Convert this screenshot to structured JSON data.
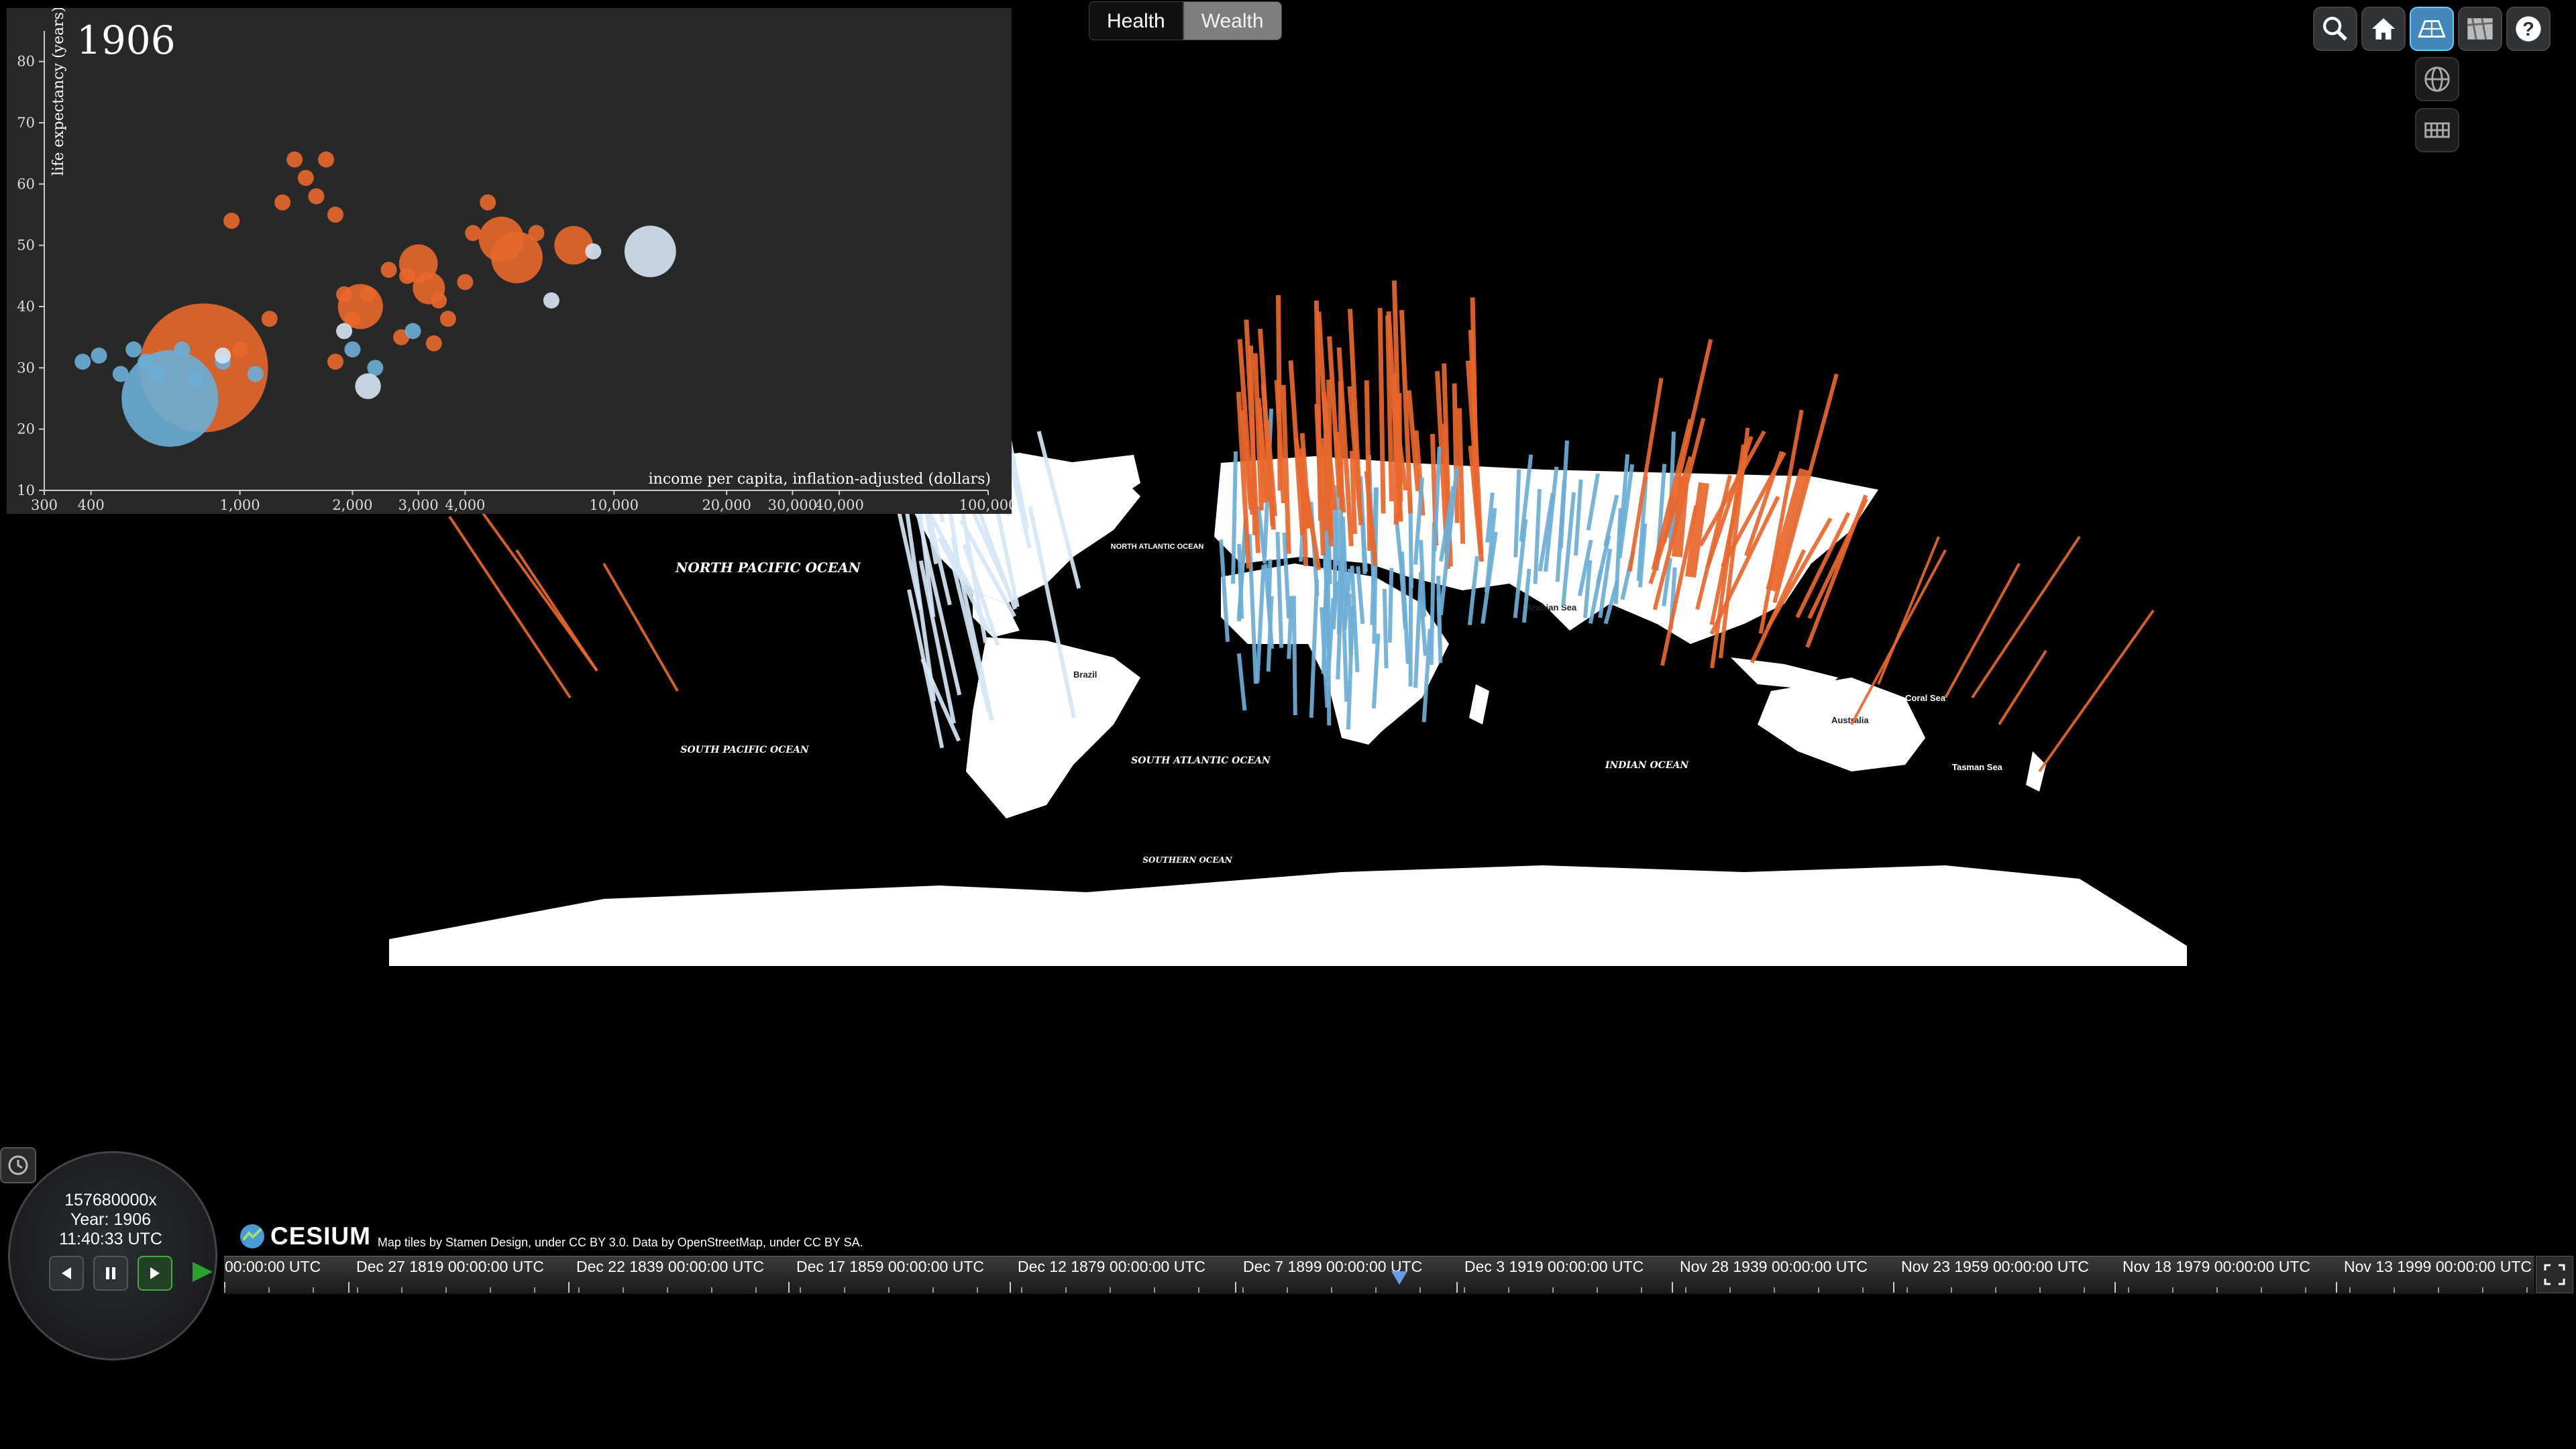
{
  "tabs": [
    {
      "label": "Health",
      "active": true
    },
    {
      "label": "Wealth",
      "active": false
    }
  ],
  "toolbar": {
    "buttons": [
      "search-icon",
      "home-icon",
      "map-2d-icon",
      "map-columbus-icon",
      "help-icon"
    ],
    "picker": [
      "globe-icon",
      "grid-icon"
    ]
  },
  "chart": {
    "year": "1906",
    "ylabel": "life expectancy (years)",
    "xlabel": "income per capita, inflation-adjusted (dollars)",
    "y_ticks": [
      "80",
      "70",
      "60",
      "50",
      "40",
      "30",
      "20",
      "10"
    ],
    "x_ticks": [
      "300",
      "400",
      "1,000",
      "2,000",
      "3,000",
      "4,000",
      "10,000",
      "20,000",
      "30,000",
      "40,000",
      "100,000"
    ]
  },
  "chart_data": {
    "type": "scatter",
    "title": "1906",
    "xlabel": "income per capita, inflation-adjusted (dollars)",
    "ylabel": "life expectancy (years)",
    "x_scale": "log",
    "xlim": [
      300,
      100000
    ],
    "ylim": [
      10,
      85
    ],
    "series": [
      {
        "name": "",
        "color": "#e8672c",
        "points": [
          {
            "x": 800,
            "y": 30,
            "r": 40
          },
          {
            "x": 950,
            "y": 54
          },
          {
            "x": 1300,
            "y": 57
          },
          {
            "x": 1400,
            "y": 64
          },
          {
            "x": 1500,
            "y": 61
          },
          {
            "x": 1600,
            "y": 58
          },
          {
            "x": 1700,
            "y": 64
          },
          {
            "x": 1800,
            "y": 55
          },
          {
            "x": 2000,
            "y": 38
          },
          {
            "x": 2100,
            "y": 40,
            "r": 14
          },
          {
            "x": 2200,
            "y": 42
          },
          {
            "x": 2500,
            "y": 46
          },
          {
            "x": 2800,
            "y": 45
          },
          {
            "x": 3000,
            "y": 47,
            "r": 12
          },
          {
            "x": 3200,
            "y": 43,
            "r": 10
          },
          {
            "x": 3400,
            "y": 41
          },
          {
            "x": 3600,
            "y": 38
          },
          {
            "x": 4000,
            "y": 44
          },
          {
            "x": 4200,
            "y": 52
          },
          {
            "x": 4600,
            "y": 57
          },
          {
            "x": 5000,
            "y": 51,
            "r": 14
          },
          {
            "x": 5500,
            "y": 48,
            "r": 16
          },
          {
            "x": 6200,
            "y": 52
          },
          {
            "x": 7800,
            "y": 50,
            "r": 12
          },
          {
            "x": 1900,
            "y": 42
          },
          {
            "x": 1200,
            "y": 38
          },
          {
            "x": 1000,
            "y": 33
          },
          {
            "x": 1800,
            "y": 31
          },
          {
            "x": 2700,
            "y": 35
          },
          {
            "x": 3300,
            "y": 34
          }
        ]
      },
      {
        "name": "",
        "color": "#6baed6",
        "points": [
          {
            "x": 650,
            "y": 25,
            "r": 30
          },
          {
            "x": 380,
            "y": 31
          },
          {
            "x": 420,
            "y": 32
          },
          {
            "x": 480,
            "y": 29
          },
          {
            "x": 520,
            "y": 33
          },
          {
            "x": 560,
            "y": 31
          },
          {
            "x": 600,
            "y": 29
          },
          {
            "x": 700,
            "y": 33
          },
          {
            "x": 760,
            "y": 28
          },
          {
            "x": 900,
            "y": 31
          },
          {
            "x": 1100,
            "y": 29
          },
          {
            "x": 2000,
            "y": 33
          },
          {
            "x": 2300,
            "y": 30
          },
          {
            "x": 2900,
            "y": 36
          }
        ]
      },
      {
        "name": "",
        "color": "#d6e6f5",
        "points": [
          {
            "x": 12500,
            "y": 49,
            "r": 16
          },
          {
            "x": 2200,
            "y": 27,
            "r": 8
          },
          {
            "x": 1900,
            "y": 36
          },
          {
            "x": 8800,
            "y": 49
          },
          {
            "x": 6800,
            "y": 41
          },
          {
            "x": 900,
            "y": 32
          }
        ]
      }
    ]
  },
  "map": {
    "labels": {
      "north_pacific": "NORTH PACIFIC OCEAN",
      "south_pacific": "SOUTH PACIFIC OCEAN",
      "south_atlantic": "SOUTH ATLANTIC OCEAN",
      "north_atlantic": "NORTH ATLANTIC OCEAN",
      "indian": "INDIAN OCEAN",
      "southern": "SOUTHERN OCEAN",
      "brazil": "Brazil",
      "australia": "Australia",
      "arabian_sea": "Arabian Sea",
      "coral_sea": "Coral Sea",
      "tasman_sea": "Tasman Sea"
    }
  },
  "animation": {
    "multiplier": "157680000x",
    "year": "Year: 1906",
    "time": "11:40:33 UTC"
  },
  "credits": {
    "logo": "CESIUM",
    "text": "Map tiles by Stamen Design, under CC BY 3.0. Data by OpenStreetMap, under CC BY SA."
  },
  "timeline": {
    "labels": [
      "00:00:00 UTC",
      "Dec 27 1819 00:00:00 UTC",
      "Dec 22 1839 00:00:00 UTC",
      "Dec 17 1859 00:00:00 UTC",
      "Dec 12 1879 00:00:00 UTC",
      "Dec 7 1899 00:00:00 UTC",
      "Dec 3 1919 00:00:00 UTC",
      "Nov 28 1939 00:00:00 UTC",
      "Nov 23 1959 00:00:00 UTC",
      "Nov 18 1979 00:00:00 UTC",
      "Nov 13 1999 00:00:00 UTC"
    ]
  },
  "colors": {
    "orange": "#e8672c",
    "blue": "#6baed6",
    "pale": "#d6e6f5",
    "land": "#ffffff",
    "ocean": "#000000"
  }
}
